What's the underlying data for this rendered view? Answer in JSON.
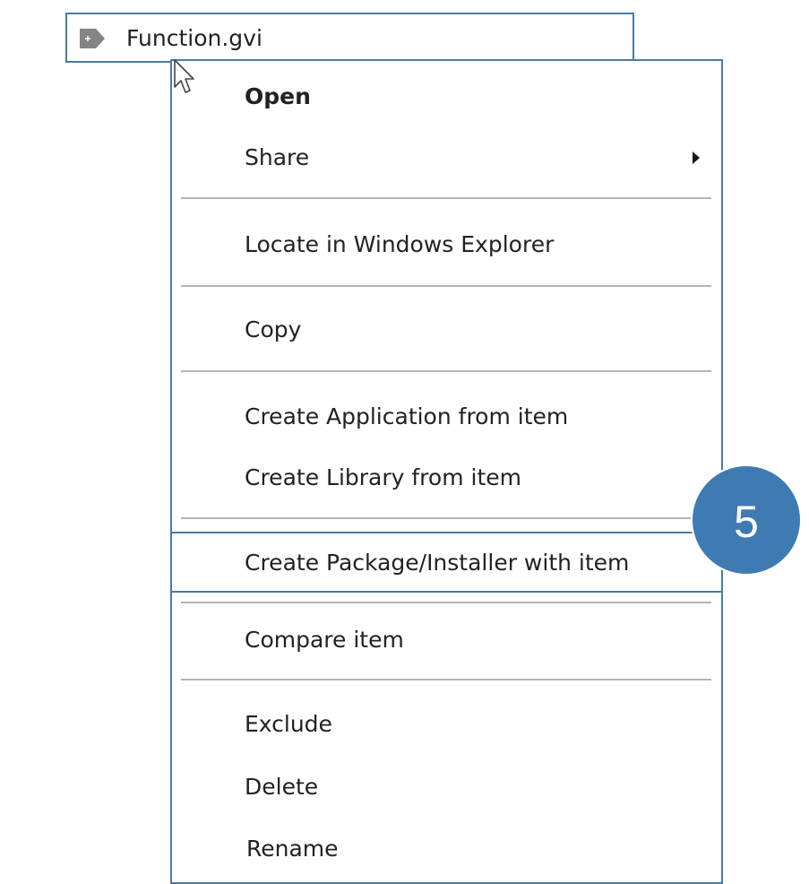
{
  "file": {
    "name": "Function.gvi",
    "icon": "play-file-icon"
  },
  "menu": {
    "open": "Open",
    "share": "Share",
    "locate": "Locate in Windows Explorer",
    "copy": "Copy",
    "create_application": "Create Application from item",
    "create_library": "Create Library from item",
    "create_package": "Create Package/Installer with item",
    "compare": "Compare item",
    "exclude": "Exclude",
    "delete": "Delete",
    "rename": "Rename"
  },
  "badge": {
    "step": "5"
  },
  "colors": {
    "accent": "#3f7bb3",
    "border": "#4a7ba8",
    "separator": "#b4b4b4"
  }
}
